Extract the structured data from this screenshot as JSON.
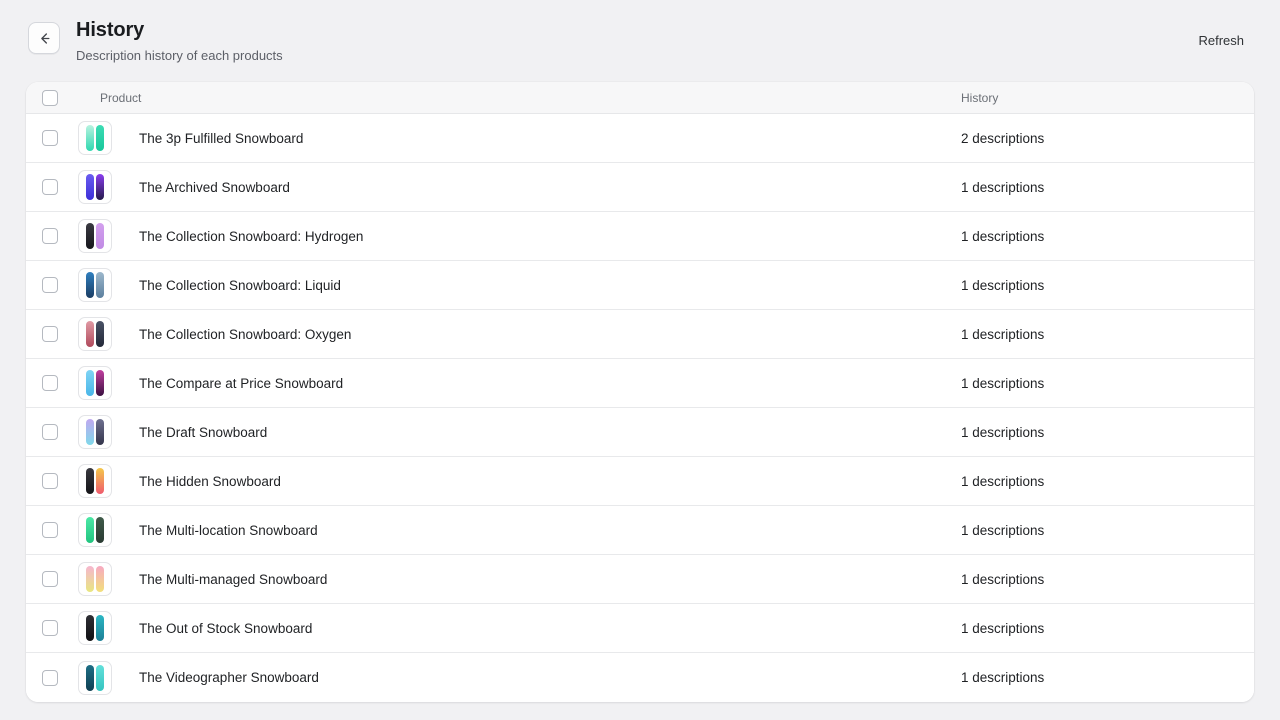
{
  "header": {
    "back_icon": "arrow-left-icon",
    "title": "History",
    "subtitle": "Description history of each products",
    "refresh_label": "Refresh"
  },
  "table": {
    "columns": {
      "product": "Product",
      "history": "History"
    },
    "rows": [
      {
        "product": "The 3p Fulfilled Snowboard",
        "history": "2 descriptions",
        "thumb": [
          "linear-gradient(180deg,#b8f3e0,#2fd9b0)",
          "linear-gradient(180deg,#3ddcb4,#17c79b)"
        ]
      },
      {
        "product": "The Archived Snowboard",
        "history": "1 descriptions",
        "thumb": [
          "linear-gradient(180deg,#6a5cf0,#3c2fd8)",
          "linear-gradient(180deg,#8a3df0,#241a4a)"
        ]
      },
      {
        "product": "The Collection Snowboard: Hydrogen",
        "history": "1 descriptions",
        "thumb": [
          "linear-gradient(180deg,#3a3a42,#17171c)",
          "linear-gradient(180deg,#d3a0ee,#c08ae4)"
        ]
      },
      {
        "product": "The Collection Snowboard: Liquid",
        "history": "1 descriptions",
        "thumb": [
          "linear-gradient(180deg,#2f7fbf,#1b3d63)",
          "linear-gradient(180deg,#9db8cc,#5b7f9e)"
        ]
      },
      {
        "product": "The Collection Snowboard: Oxygen",
        "history": "1 descriptions",
        "thumb": [
          "linear-gradient(180deg,#e09aa4,#b04a5c)",
          "linear-gradient(180deg,#4a5266,#232838)"
        ]
      },
      {
        "product": "The Compare at Price Snowboard",
        "history": "1 descriptions",
        "thumb": [
          "linear-gradient(180deg,#7fd4f5,#49b6e8)",
          "linear-gradient(180deg,#c23fa0,#3a1040)"
        ]
      },
      {
        "product": "The Draft Snowboard",
        "history": "1 descriptions",
        "thumb": [
          "linear-gradient(180deg,#c0a8f0,#7fd9ea)",
          "linear-gradient(180deg,#6e7090,#33344a)"
        ]
      },
      {
        "product": "The Hidden Snowboard",
        "history": "1 descriptions",
        "thumb": [
          "linear-gradient(180deg,#39393f,#141418)",
          "linear-gradient(180deg,#f4c84a,#ef5a6e)"
        ]
      },
      {
        "product": "The Multi-location Snowboard",
        "history": "1 descriptions",
        "thumb": [
          "linear-gradient(180deg,#4ce8a6,#21c47f)",
          "linear-gradient(180deg,#3f5b4a,#2a3a32)"
        ]
      },
      {
        "product": "The Multi-managed Snowboard",
        "history": "1 descriptions",
        "thumb": [
          "linear-gradient(180deg,#f6b6cf,#e8e77f)",
          "linear-gradient(180deg,#f7a9c2,#f2e07a)"
        ]
      },
      {
        "product": "The Out of Stock Snowboard",
        "history": "1 descriptions",
        "thumb": [
          "linear-gradient(180deg,#2e2e34,#101014)",
          "linear-gradient(180deg,#2bb7c4,#1d7f96)"
        ]
      },
      {
        "product": "The Videographer Snowboard",
        "history": "1 descriptions",
        "thumb": [
          "linear-gradient(180deg,#1d6f86,#0f3f52)",
          "linear-gradient(180deg,#63e0db,#35c4c0)"
        ]
      }
    ]
  }
}
